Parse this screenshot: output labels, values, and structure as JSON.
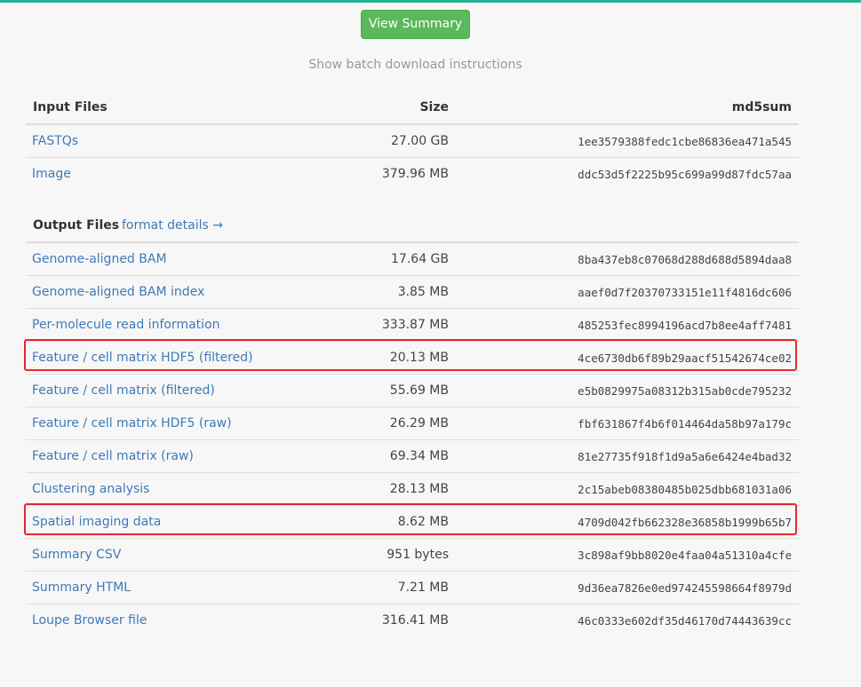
{
  "top_button": {
    "label": "View Summary"
  },
  "batch_link": "Show batch download instructions",
  "input_section": {
    "headers": {
      "name": "Input Files",
      "size": "Size",
      "md5": "md5sum"
    },
    "rows": [
      {
        "name": "FASTQs",
        "size": "27.00 GB",
        "md5": "1ee3579388fedc1cbe86836ea471a545"
      },
      {
        "name": "Image",
        "size": "379.96 MB",
        "md5": "ddc53d5f2225b95c699a99d87fdc57aa"
      }
    ]
  },
  "output_section": {
    "headers": {
      "name": "Output Files",
      "format_link": "format details →"
    },
    "rows": [
      {
        "name": "Genome-aligned BAM",
        "size": "17.64 GB",
        "md5": "8ba437eb8c07068d288d688d5894daa8"
      },
      {
        "name": "Genome-aligned BAM index",
        "size": "3.85 MB",
        "md5": "aaef0d7f20370733151e11f4816dc606"
      },
      {
        "name": "Per-molecule read information",
        "size": "333.87 MB",
        "md5": "485253fec8994196acd7b8ee4aff7481"
      },
      {
        "name": "Feature / cell matrix HDF5 (filtered)",
        "size": "20.13 MB",
        "md5": "4ce6730db6f89b29aacf51542674ce02",
        "highlighted": true
      },
      {
        "name": "Feature / cell matrix (filtered)",
        "size": "55.69 MB",
        "md5": "e5b0829975a08312b315ab0cde795232"
      },
      {
        "name": "Feature / cell matrix HDF5 (raw)",
        "size": "26.29 MB",
        "md5": "fbf631867f4b6f014464da58b97a179c"
      },
      {
        "name": "Feature / cell matrix (raw)",
        "size": "69.34 MB",
        "md5": "81e27735f918f1d9a5a6e6424e4bad32"
      },
      {
        "name": "Clustering analysis",
        "size": "28.13 MB",
        "md5": "2c15abeb08380485b025dbb681031a06"
      },
      {
        "name": "Spatial imaging data",
        "size": "8.62 MB",
        "md5": "4709d042fb662328e36858b1999b65b7",
        "highlighted": true
      },
      {
        "name": "Summary CSV",
        "size": "951 bytes",
        "md5": "3c898af9bb8020e4faa04a51310a4cfe"
      },
      {
        "name": "Summary HTML",
        "size": "7.21 MB",
        "md5": "9d36ea7826e0ed974245598664f8979d"
      },
      {
        "name": "Loupe Browser file",
        "size": "316.41 MB",
        "md5": "46c0333e602df35d46170d74443639cc"
      }
    ]
  },
  "colors": {
    "accent": "#27b398",
    "button": "#5cb85c",
    "link": "#3d7ab8",
    "highlight": "#e8262a"
  }
}
